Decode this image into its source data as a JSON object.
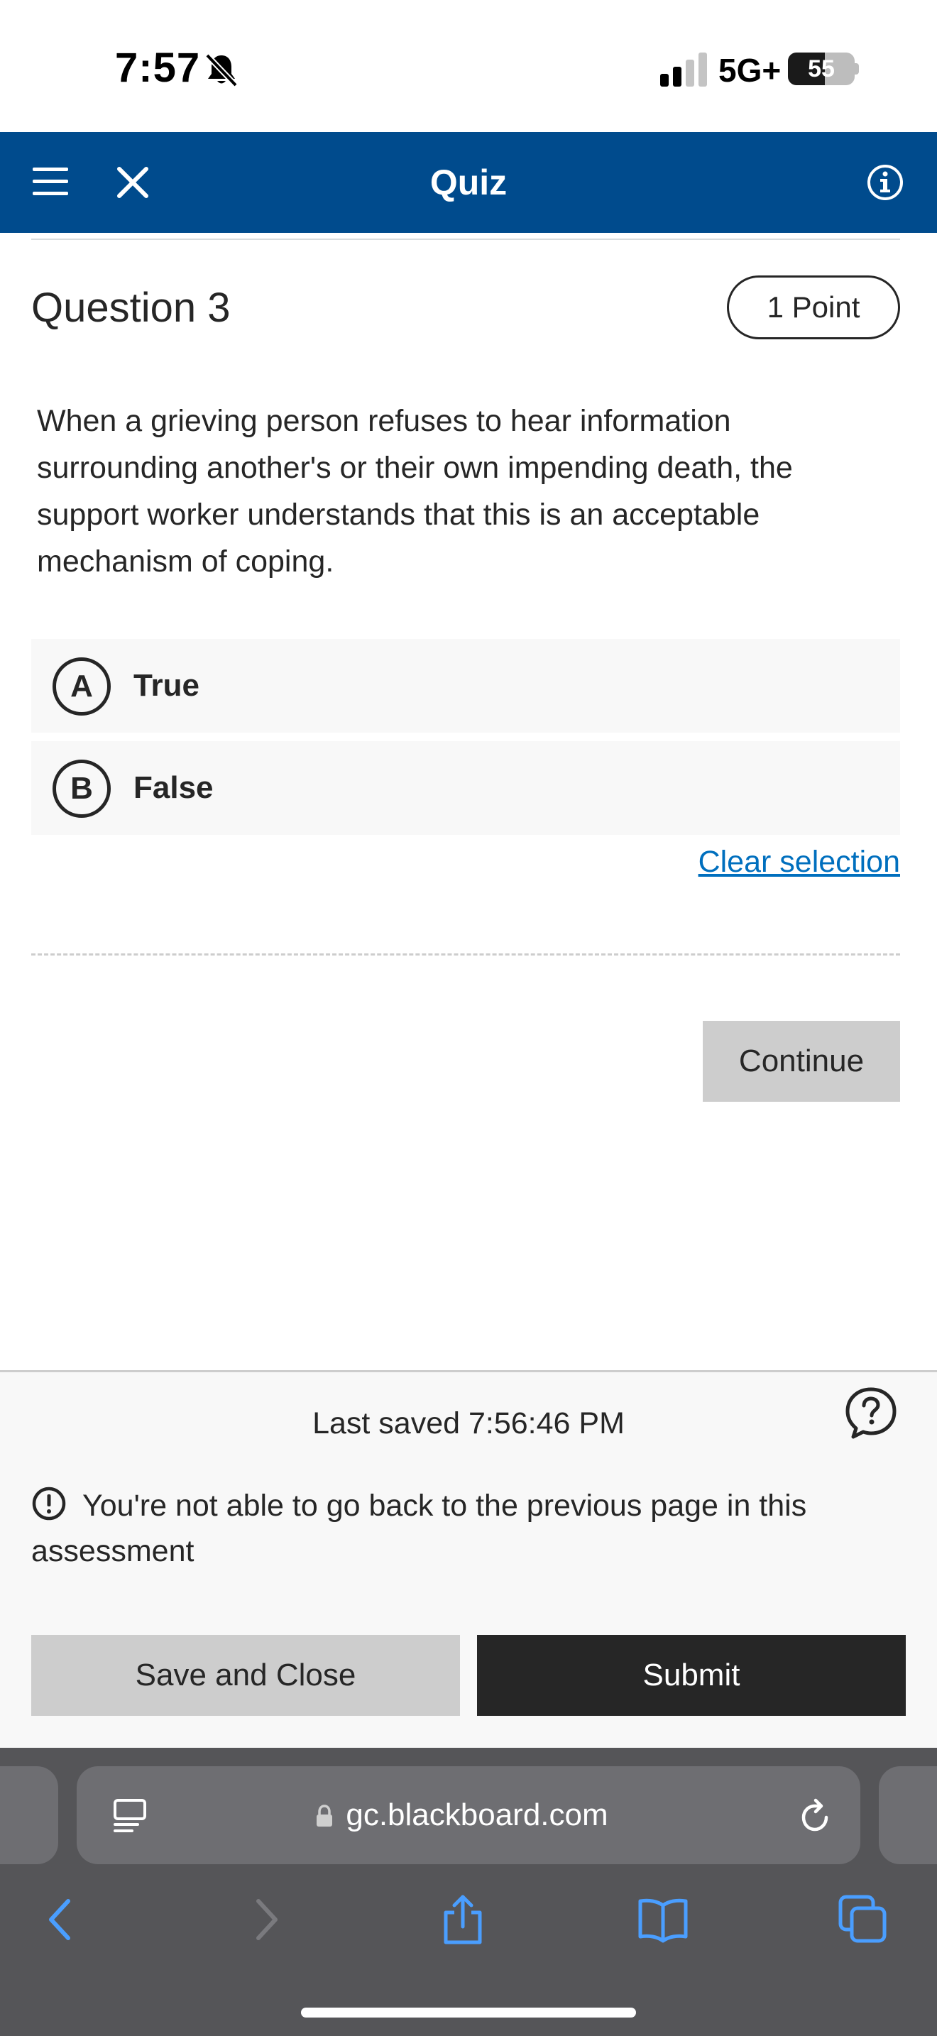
{
  "status_bar": {
    "time": "7:57",
    "network": "5G+",
    "battery": "55"
  },
  "header": {
    "title": "Quiz",
    "icons": [
      "menu-icon",
      "close-icon",
      "info-icon"
    ]
  },
  "question": {
    "title": "Question 3",
    "points": "1 Point",
    "text": "When a grieving person refuses to hear information surrounding another's or their own impending death, the support worker understands that this is an acceptable mechanism of coping.",
    "options": [
      {
        "letter": "A",
        "label": "True"
      },
      {
        "letter": "B",
        "label": "False"
      }
    ],
    "clear_selection": "Clear selection"
  },
  "actions": {
    "continue_label": "Continue"
  },
  "footer": {
    "last_saved": "Last saved 7:56:46 PM",
    "notice": "You're not able to go back to the previous page in this assessment",
    "save_close_label": "Save and Close",
    "submit_label": "Submit"
  },
  "browser": {
    "url": "gc.blackboard.com"
  },
  "colors": {
    "header_bg": "#004b8d",
    "link": "#006fbe",
    "submit_bg": "#262626",
    "secondary_button_bg": "#cdcdcd",
    "browser_bg": "#555558",
    "browser_icon": "#4a9eff"
  }
}
